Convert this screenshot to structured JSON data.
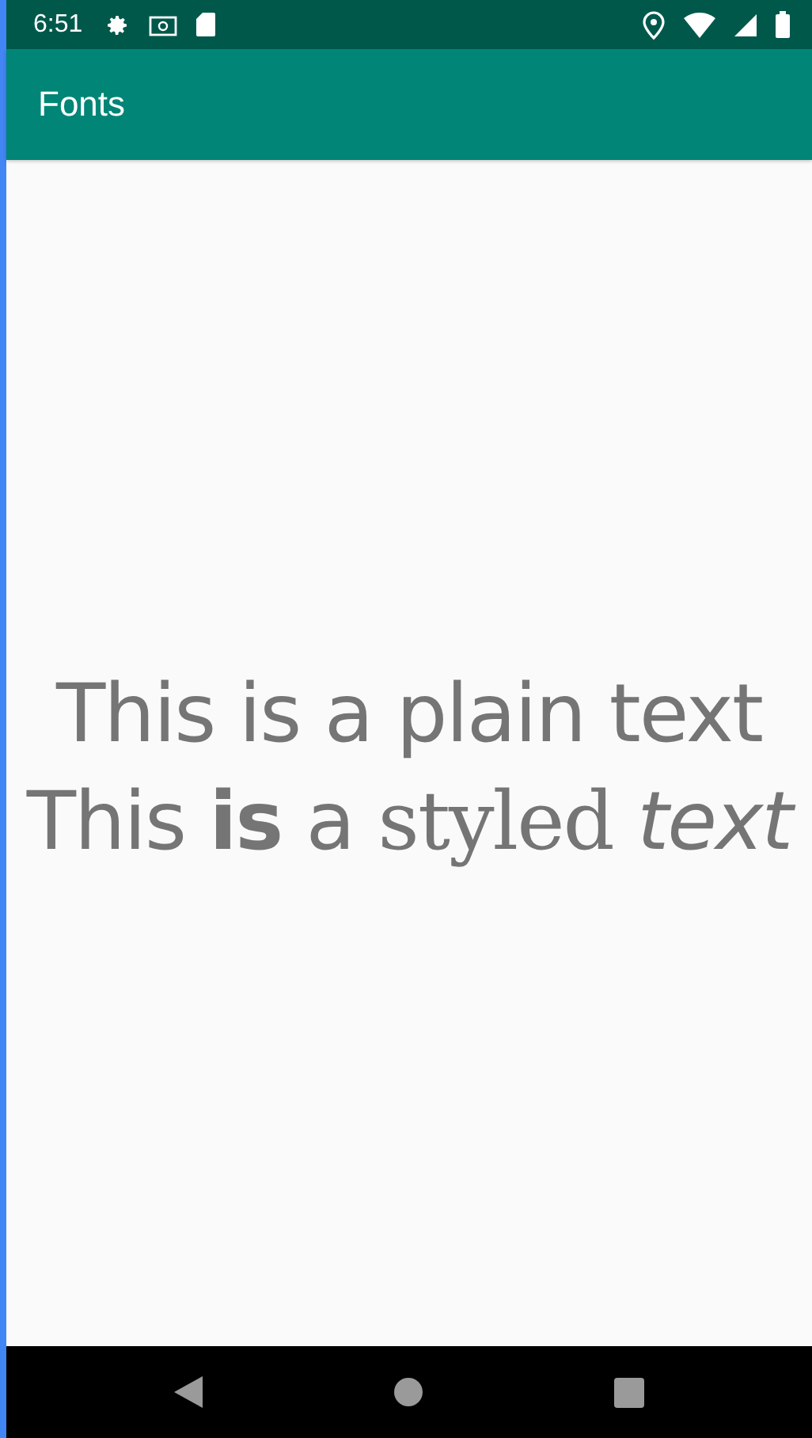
{
  "status_bar": {
    "time": "6:51"
  },
  "app_bar": {
    "title": "Fonts"
  },
  "content": {
    "plain_text": "This is a plain text",
    "styled_text": [
      {
        "kind": "regular",
        "text": "This "
      },
      {
        "kind": "bold",
        "text": "is"
      },
      {
        "kind": "regular",
        "text": " a "
      },
      {
        "kind": "serif",
        "text": "styled "
      },
      {
        "kind": "italic",
        "text": "text"
      }
    ]
  }
}
